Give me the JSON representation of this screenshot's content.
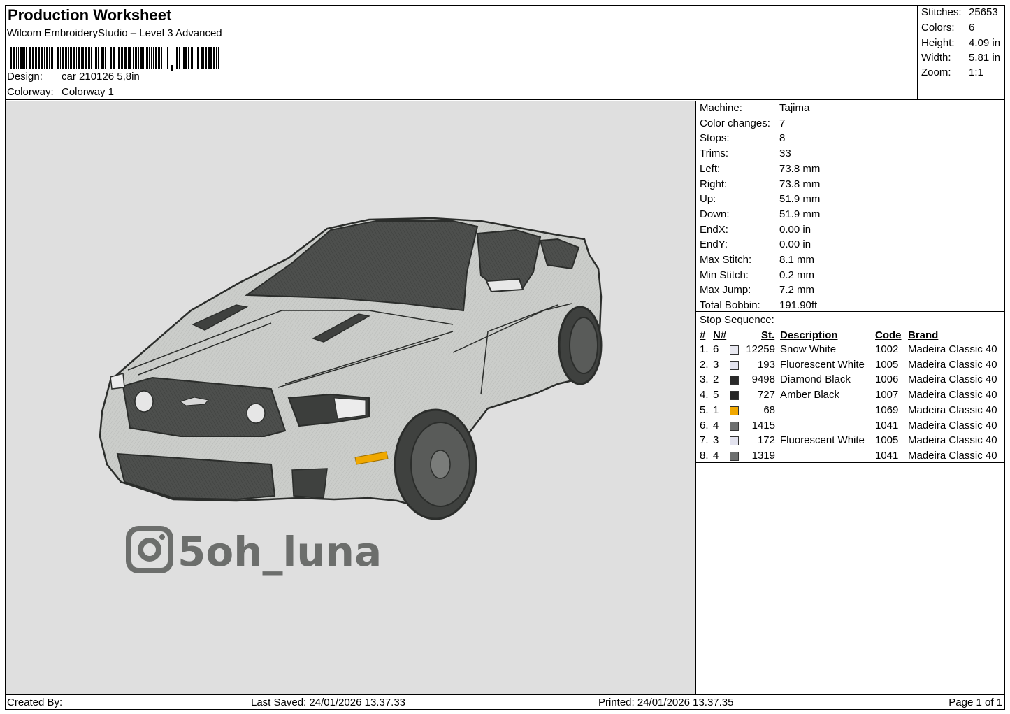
{
  "header": {
    "title": "Production Worksheet",
    "software": "Wilcom EmbroideryStudio – Level 3 Advanced",
    "design_label": "Design:",
    "design_value": "car 210126 5,8in",
    "colorway_label": "Colorway:",
    "colorway_value": "Colorway 1"
  },
  "stats": [
    {
      "label": "Stitches:",
      "value": "25653"
    },
    {
      "label": "Colors:",
      "value": "6"
    },
    {
      "label": "Height:",
      "value": "4.09 in"
    },
    {
      "label": "Width:",
      "value": "5.81 in"
    },
    {
      "label": "Zoom:",
      "value": "1:1"
    }
  ],
  "preview": {
    "logo_text": "5oh_luna",
    "colors": {
      "background": "#dfdfdf",
      "body": "#c9cbc8",
      "outline": "#2b2d2b",
      "dark": "#4a4c4a",
      "accent": "#f0a800"
    }
  },
  "machine_info": [
    {
      "label": "Machine:",
      "value": "Tajima"
    },
    {
      "label": "Color changes:",
      "value": "7"
    },
    {
      "label": "Stops:",
      "value": "8"
    },
    {
      "label": "Trims:",
      "value": "33"
    },
    {
      "label": "Left:",
      "value": "73.8 mm"
    },
    {
      "label": "Right:",
      "value": "73.8 mm"
    },
    {
      "label": "Up:",
      "value": "51.9 mm"
    },
    {
      "label": "Down:",
      "value": "51.9 mm"
    },
    {
      "label": "EndX:",
      "value": "0.00 in"
    },
    {
      "label": "EndY:",
      "value": "0.00 in"
    },
    {
      "label": "Max Stitch:",
      "value": "8.1 mm"
    },
    {
      "label": "Min Stitch:",
      "value": "0.2 mm"
    },
    {
      "label": "Max Jump:",
      "value": "7.2 mm"
    },
    {
      "label": "Total Bobbin:",
      "value": "191.90ft"
    }
  ],
  "stop_sequence": {
    "caption": "Stop Sequence:",
    "headers": {
      "num": "#",
      "n": "N#",
      "st": "St.",
      "description": "Description",
      "code": "Code",
      "brand": "Brand"
    },
    "rows": [
      {
        "num": "1.",
        "n": "6",
        "color": "#e8e8f0",
        "st": "12259",
        "description": "Snow White",
        "code": "1002",
        "brand": "Madeira Classic 40"
      },
      {
        "num": "2.",
        "n": "3",
        "color": "#e2e2ee",
        "st": "193",
        "description": "Fluorescent White",
        "code": "1005",
        "brand": "Madeira Classic 40"
      },
      {
        "num": "3.",
        "n": "2",
        "color": "#2a2a2a",
        "st": "9498",
        "description": "Diamond Black",
        "code": "1006",
        "brand": "Madeira Classic 40"
      },
      {
        "num": "4.",
        "n": "5",
        "color": "#262626",
        "st": "727",
        "description": "Amber Black",
        "code": "1007",
        "brand": "Madeira Classic 40"
      },
      {
        "num": "5.",
        "n": "1",
        "color": "#f0a800",
        "st": "68",
        "description": "",
        "code": "1069",
        "brand": "Madeira Classic 40"
      },
      {
        "num": "6.",
        "n": "4",
        "color": "#6e7070",
        "st": "1415",
        "description": "",
        "code": "1041",
        "brand": "Madeira Classic 40"
      },
      {
        "num": "7.",
        "n": "3",
        "color": "#e2e2ee",
        "st": "172",
        "description": "Fluorescent White",
        "code": "1005",
        "brand": "Madeira Classic 40"
      },
      {
        "num": "8.",
        "n": "4",
        "color": "#6e7070",
        "st": "1319",
        "description": "",
        "code": "1041",
        "brand": "Madeira Classic 40"
      }
    ]
  },
  "footer": {
    "created_by": "Created By:",
    "last_saved": "Last Saved: 24/01/2026 13.37.33",
    "printed": "Printed: 24/01/2026 13.37.35",
    "page": "Page 1 of 1"
  }
}
